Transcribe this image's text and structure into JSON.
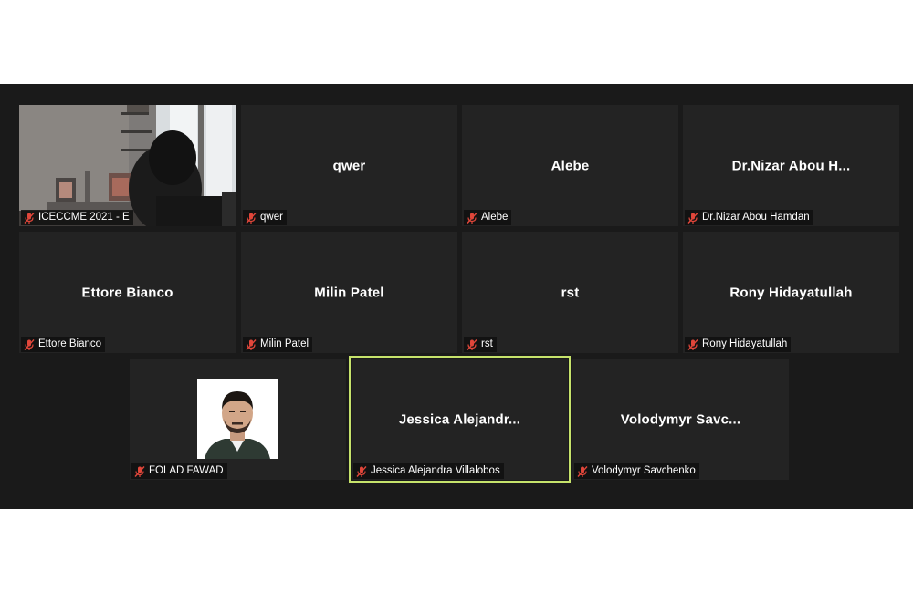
{
  "colors": {
    "background": "#1a1a1a",
    "tile": "#232323",
    "active_border": "#c6e36b",
    "muted_icon": "#e0463a"
  },
  "participants": [
    {
      "label": "ICECCME 2021 - E",
      "center_name": "",
      "video": true,
      "muted": true
    },
    {
      "label": "qwer",
      "center_name": "qwer",
      "muted": true
    },
    {
      "label": "Alebe",
      "center_name": "Alebe",
      "muted": true
    },
    {
      "label": "Dr.Nizar Abou Hamdan",
      "center_name": "Dr.Nizar Abou H...",
      "muted": true
    },
    {
      "label": "Ettore Bianco",
      "center_name": "Ettore Bianco",
      "muted": true
    },
    {
      "label": "Milin Patel",
      "center_name": "Milin Patel",
      "muted": true
    },
    {
      "label": "rst",
      "center_name": "rst",
      "muted": true
    },
    {
      "label": "Rony Hidayatullah",
      "center_name": "Rony Hidayatullah",
      "muted": true
    },
    {
      "label": "FOLAD FAWAD",
      "center_name": "",
      "photo": true,
      "muted": true
    },
    {
      "label": "Jessica Alejandra Villalobos",
      "center_name": "Jessica Alejandr...",
      "active": true,
      "muted": true
    },
    {
      "label": "Volodymyr Savchenko",
      "center_name": "Volodymyr Savc...",
      "muted": true
    }
  ],
  "icons": {
    "muted": "mic-muted-icon"
  }
}
